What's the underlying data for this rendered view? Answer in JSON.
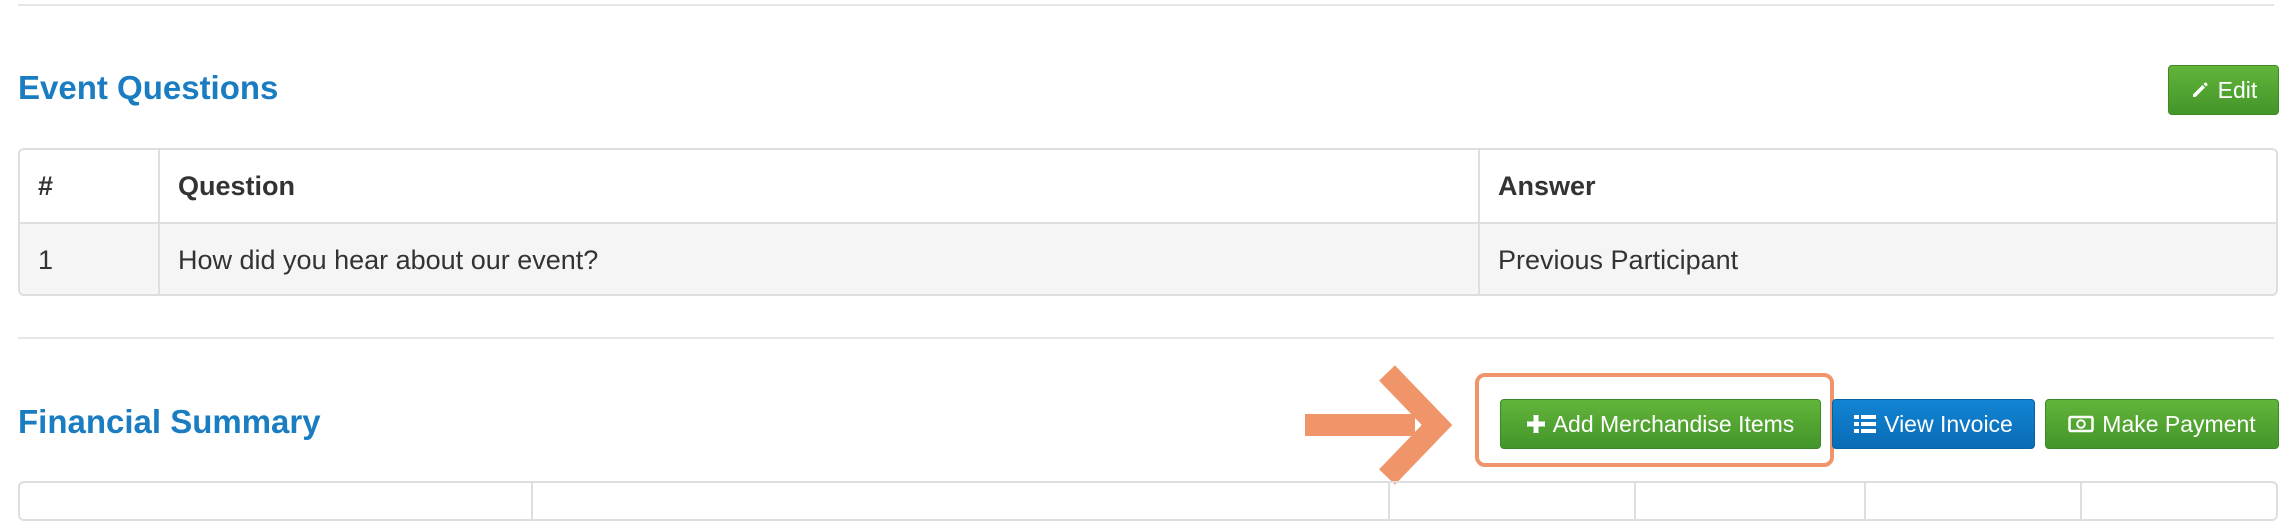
{
  "event_questions": {
    "title": "Event Questions",
    "edit_label": "Edit",
    "columns": [
      "#",
      "Question",
      "Answer"
    ],
    "rows": [
      {
        "num": "1",
        "question": "How did you hear about our event?",
        "answer": "Previous Participant"
      }
    ]
  },
  "financial_summary": {
    "title": "Financial Summary",
    "add_merch_label": "Add Merchandise Items",
    "view_invoice_label": "View Invoice",
    "make_payment_label": "Make Payment"
  },
  "icons": {
    "edit": "pencil-icon",
    "add": "plus-icon",
    "invoice": "list-icon",
    "payment": "money-icon",
    "callout": "arrow-right-icon"
  },
  "colors": {
    "heading": "#1a7cc1",
    "green_button": "#4cae32",
    "blue_button": "#0e7ac7",
    "highlight": "#f0946a"
  }
}
